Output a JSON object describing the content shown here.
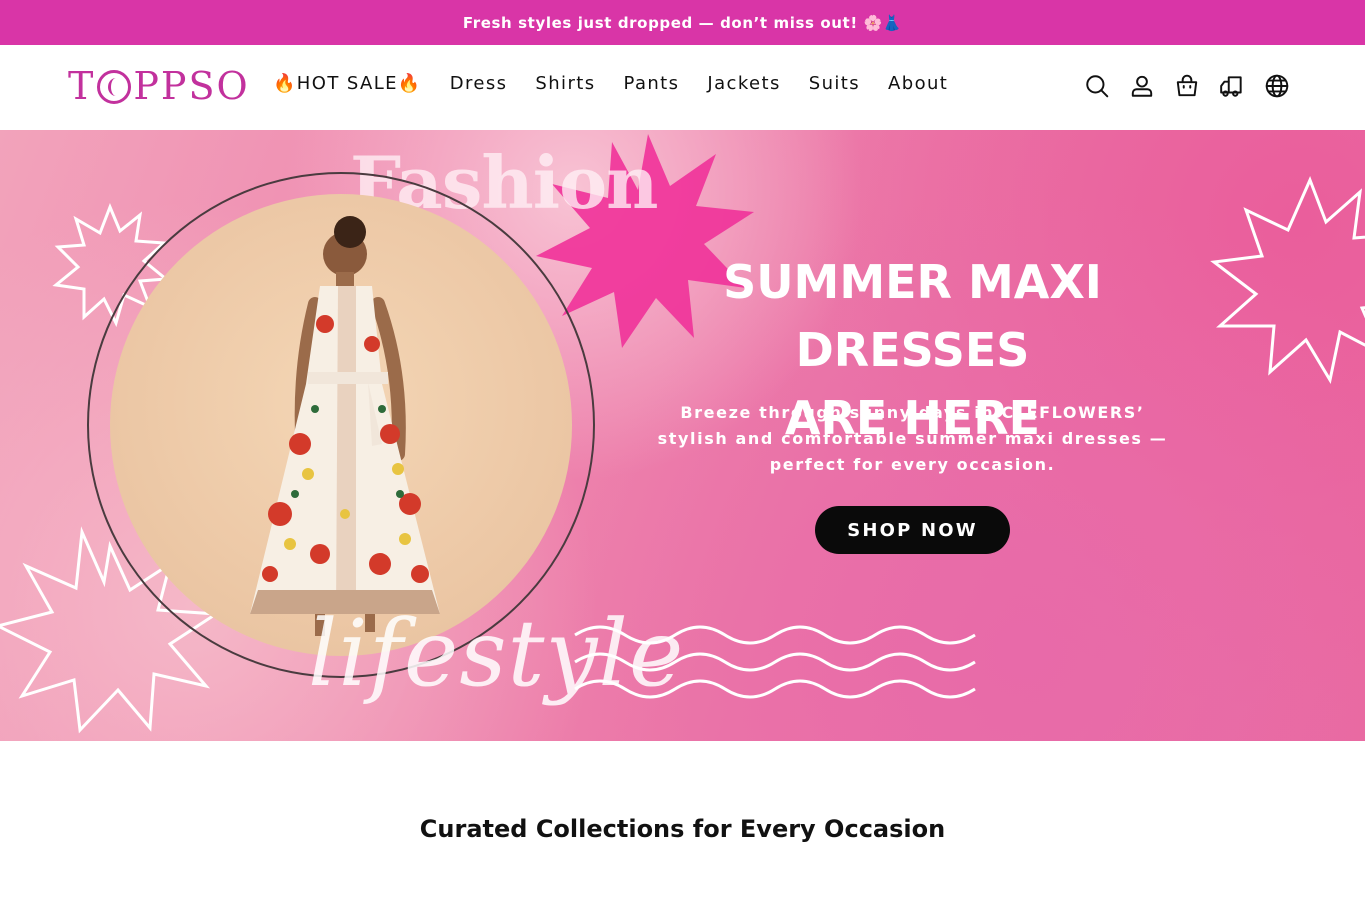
{
  "announcement": {
    "text": "Fresh styles just dropped — don’t miss out! 🌸👗"
  },
  "header": {
    "logo_text_left": "T",
    "logo_text_right": "PPSO",
    "nav": [
      {
        "label": "🔥HOT SALE🔥"
      },
      {
        "label": "Dress"
      },
      {
        "label": "Shirts"
      },
      {
        "label": "Pants"
      },
      {
        "label": "Jackets"
      },
      {
        "label": "Suits"
      },
      {
        "label": "About"
      }
    ],
    "icons": [
      "search-icon",
      "account-icon",
      "cart-icon",
      "track-order-icon",
      "language-globe-icon"
    ]
  },
  "hero": {
    "word_fashion": "Fashion",
    "word_lifestyle": "lifestyle",
    "headline_line1": "SUMMER MAXI DRESSES",
    "headline_line2": "ARE HERE",
    "subcopy_line1": "Breeze through sunny days in CLEFLOWERS’",
    "subcopy_line2": "stylish and comfortable summer maxi dresses —",
    "subcopy_line3": "perfect for every occasion.",
    "cta_label": "SHOP NOW"
  },
  "section": {
    "title": "Curated Collections for Every Occasion"
  },
  "colors": {
    "announcement_bg": "#d935a7",
    "brand": "#c2319d",
    "hero_pink": "#eb76a7",
    "cta_bg": "#0a0a0a"
  }
}
